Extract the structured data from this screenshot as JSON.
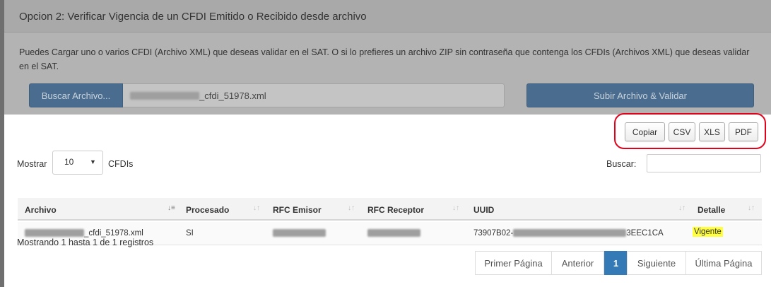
{
  "panel": {
    "title": "Opcion 2: Verificar Vigencia de un CFDI Emitido o Recibido desde archivo",
    "description": "Puedes Cargar uno o varios CFDI (Archivo XML) que deseas validar en el SAT. O si lo prefieres un archivo ZIP sin contraseña que contenga los CFDIs (Archivos XML) que deseas validar en el SAT.",
    "browse_label": "Buscar Archivo...",
    "file_name_suffix": "_cfdi_51978.xml",
    "upload_label": "Subir Archivo & Validar"
  },
  "export": {
    "copy_label": "Copiar",
    "csv_label": "CSV",
    "xls_label": "XLS",
    "pdf_label": "PDF",
    "highlight_color": "#e2001a"
  },
  "table_controls": {
    "length_prefix": "Mostrar",
    "length_value": "10",
    "length_suffix": "CFDIs",
    "search_label": "Buscar:"
  },
  "table": {
    "columns": [
      "Archivo",
      "Procesado",
      "RFC Emisor",
      "RFC Receptor",
      "UUID",
      "Detalle"
    ],
    "rows": [
      {
        "archivo_suffix": "_cfdi_51978.xml",
        "procesado": "SI",
        "uuid_prefix": "73907B02-",
        "uuid_suffix": "3EEC1CA",
        "detalle": "Vigente"
      }
    ]
  },
  "info": "Mostrando 1 hasta 1 de 1 registros",
  "pagination": {
    "first": "Primer Página",
    "prev": "Anterior",
    "current": "1",
    "next": "Siguiente",
    "last": "Última Página"
  },
  "colors": {
    "primary": "#337ab7",
    "highlight": "#ffff40"
  }
}
